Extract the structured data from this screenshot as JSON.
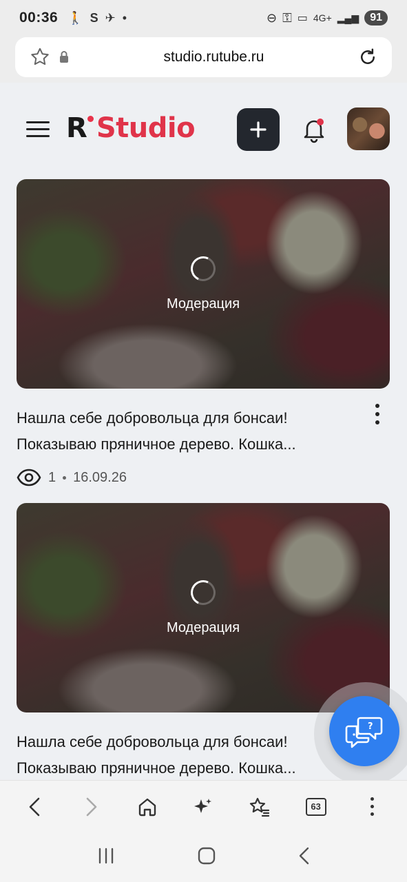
{
  "status_bar": {
    "time": "00:36",
    "network": "4G+",
    "battery": "91"
  },
  "browser": {
    "url": "studio.rutube.ru",
    "tab_count": "63"
  },
  "header": {
    "logo_letter": "R",
    "logo_text": "Studio"
  },
  "videos": [
    {
      "status": "Модерация",
      "title": "Нашла себе добровольца для бонсаи! Показываю пряничное дерево. Кошка...",
      "views": "1",
      "date": "16.09.26"
    },
    {
      "status": "Модерация",
      "title": "Нашла себе добровольца для бонсаи! Показываю пряничное дерево. Кошка...",
      "views": "",
      "date": ""
    }
  ],
  "colors": {
    "brand_red": "#e0344a",
    "fab_blue": "#2f7ff0",
    "dark_button": "#23272e"
  }
}
